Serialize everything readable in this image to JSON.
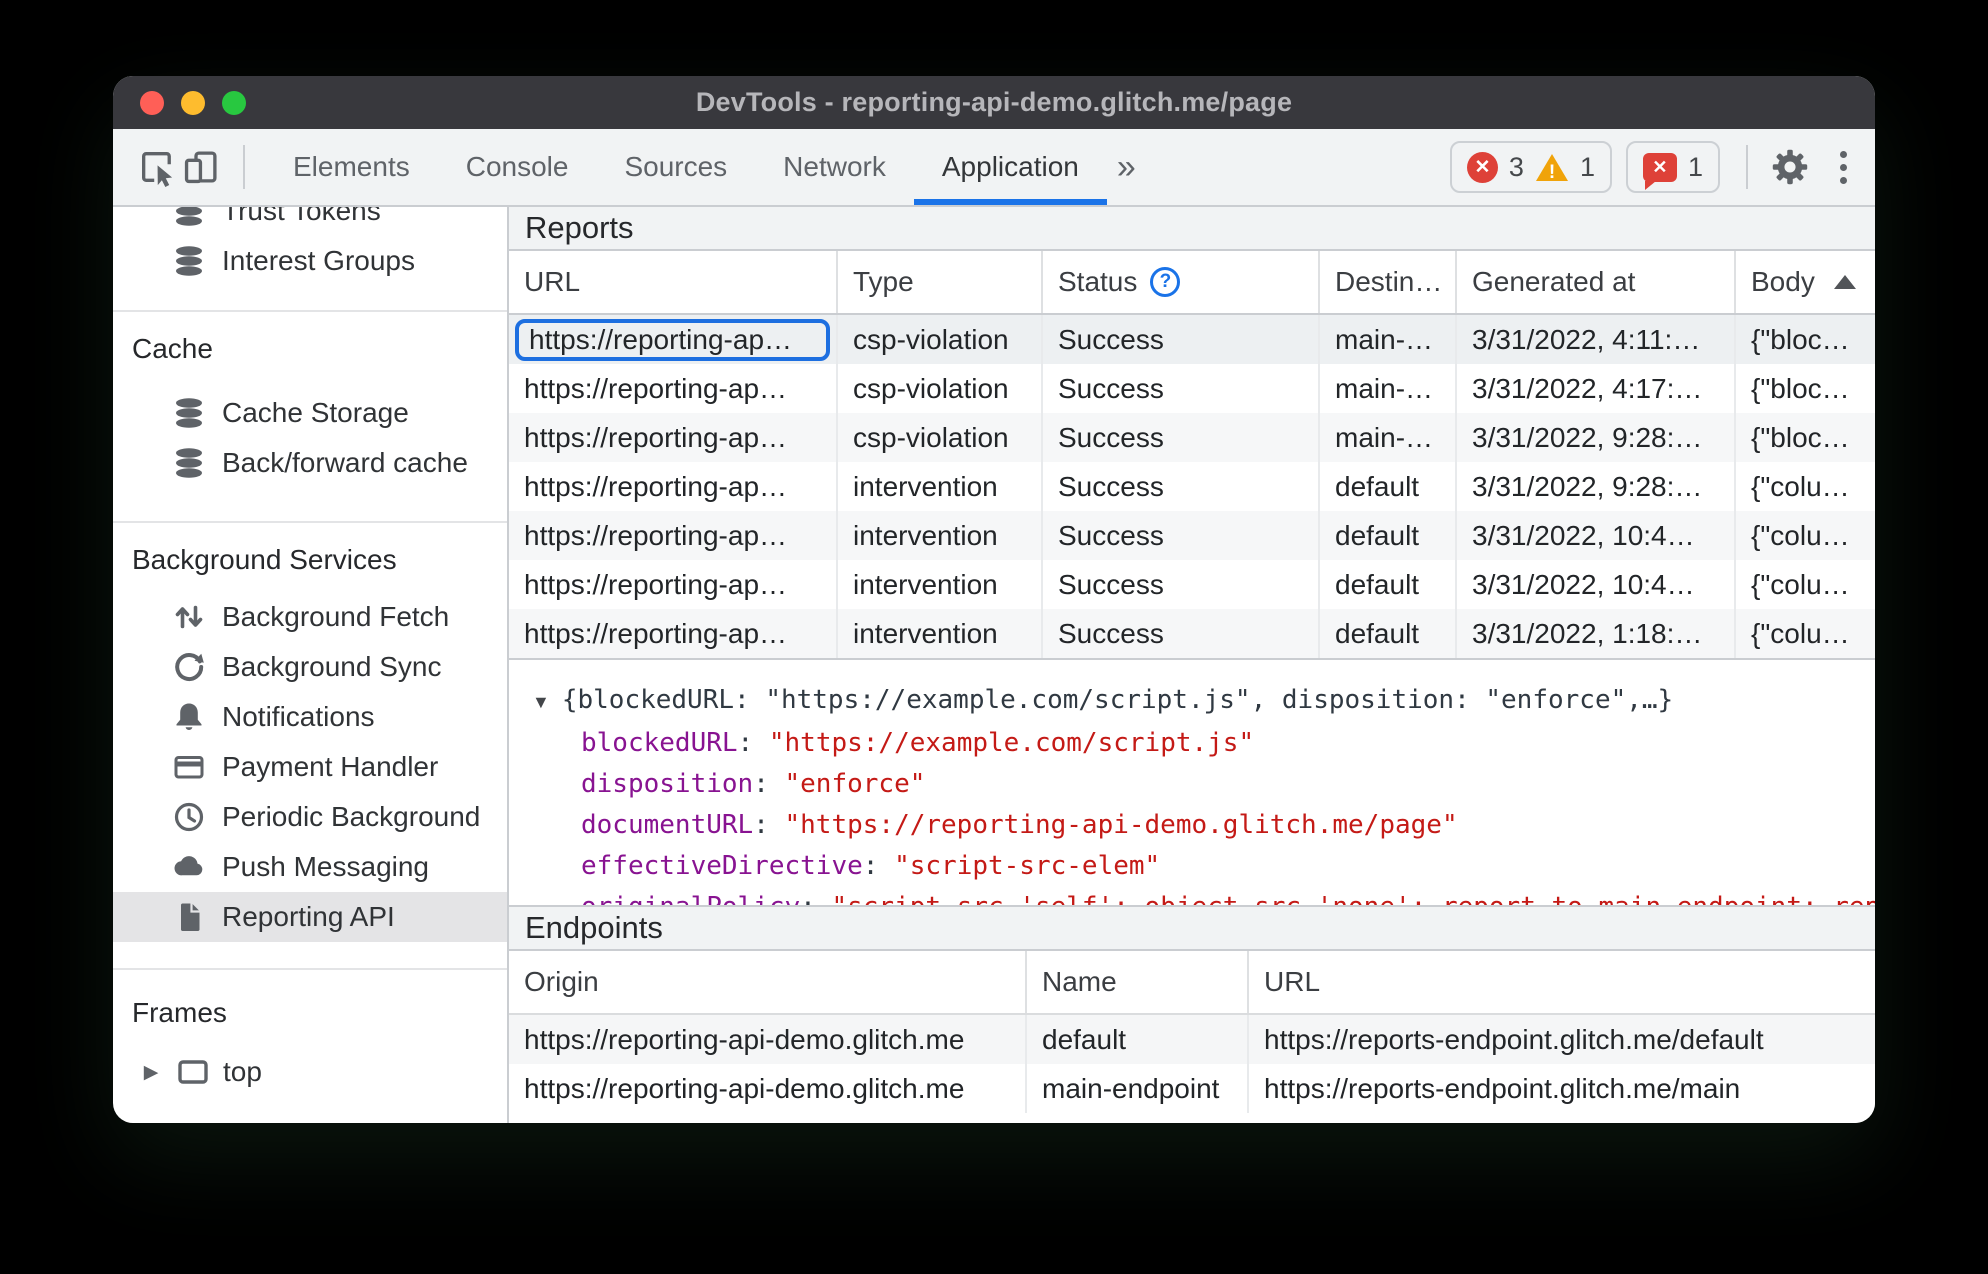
{
  "window_title": "DevTools - reporting-api-demo.glitch.me/page",
  "toolbar": {
    "tabs": {
      "elements": "Elements",
      "console": "Console",
      "sources": "Sources",
      "network": "Network",
      "application": "Application"
    },
    "more_tabs_glyph": "»",
    "badges": {
      "error_count": "3",
      "warning_count": "1",
      "issue_count": "1",
      "close_glyph": "✕",
      "warning_glyph": "!"
    }
  },
  "sidebar": {
    "item_trust_tokens": "Trust Tokens",
    "item_interest_groups": "Interest Groups",
    "section_cache": "Cache",
    "item_cache_storage": "Cache Storage",
    "item_back_forward_cache": "Back/forward cache",
    "section_background_services": "Background Services",
    "item_background_fetch": "Background Fetch",
    "item_background_sync": "Background Sync",
    "item_notifications": "Notifications",
    "item_payment_handler": "Payment Handler",
    "item_periodic_background": "Periodic Background",
    "item_push_messaging": "Push Messaging",
    "item_reporting_api": "Reporting API",
    "section_frames": "Frames",
    "item_top": "top",
    "expander_right_glyph": "▶"
  },
  "reports": {
    "title": "Reports",
    "columns": {
      "url": "URL",
      "type": "Type",
      "status": "Status",
      "status_help_glyph": "?",
      "destination": "Destin…",
      "generated_at": "Generated at",
      "body": "Body"
    },
    "rows": [
      {
        "url": "https://reporting-ap…",
        "type": "csp-violation",
        "status": "Success",
        "destination": "main-…",
        "generated_at": "3/31/2022, 4:11:…",
        "body": "{\"bloc…"
      },
      {
        "url": "https://reporting-ap…",
        "type": "csp-violation",
        "status": "Success",
        "destination": "main-…",
        "generated_at": "3/31/2022, 4:17:…",
        "body": "{\"bloc…"
      },
      {
        "url": "https://reporting-ap…",
        "type": "csp-violation",
        "status": "Success",
        "destination": "main-…",
        "generated_at": "3/31/2022, 9:28:…",
        "body": "{\"bloc…"
      },
      {
        "url": "https://reporting-ap…",
        "type": "intervention",
        "status": "Success",
        "destination": "default",
        "generated_at": "3/31/2022, 9:28:…",
        "body": "{\"colu…"
      },
      {
        "url": "https://reporting-ap…",
        "type": "intervention",
        "status": "Success",
        "destination": "default",
        "generated_at": "3/31/2022, 10:4…",
        "body": "{\"colu…"
      },
      {
        "url": "https://reporting-ap…",
        "type": "intervention",
        "status": "Success",
        "destination": "default",
        "generated_at": "3/31/2022, 10:4…",
        "body": "{\"colu…"
      },
      {
        "url": "https://reporting-ap…",
        "type": "intervention",
        "status": "Success",
        "destination": "default",
        "generated_at": "3/31/2022, 1:18:…",
        "body": "{\"colu…"
      }
    ]
  },
  "detail": {
    "expander_glyph": "▼",
    "summary": "{blockedURL: \"https://example.com/script.js\", disposition: \"enforce\",…}",
    "entries": [
      {
        "key": "blockedURL",
        "value": "\"https://example.com/script.js\""
      },
      {
        "key": "disposition",
        "value": "\"enforce\""
      },
      {
        "key": "documentURL",
        "value": "\"https://reporting-api-demo.glitch.me/page\""
      },
      {
        "key": "effectiveDirective",
        "value": "\"script-src-elem\""
      },
      {
        "key": "originalPolicy",
        "value": "\"script-src 'self'; object-src 'none'; report-to main-endpoint; report-to default\""
      }
    ]
  },
  "endpoints": {
    "title": "Endpoints",
    "columns": {
      "origin": "Origin",
      "name": "Name",
      "url": "URL"
    },
    "rows": [
      {
        "origin": "https://reporting-api-demo.glitch.me",
        "name": "default",
        "url": "https://reports-endpoint.glitch.me/default"
      },
      {
        "origin": "https://reporting-api-demo.glitch.me",
        "name": "main-endpoint",
        "url": "https://reports-endpoint.glitch.me/main"
      }
    ]
  },
  "colors": {
    "accent_blue": "#1a73e8",
    "selection_ring_blue": "#1d6fe0",
    "error_red": "#de4138",
    "warning_yellow": "#f0a30a",
    "json_key_purple": "#881391",
    "json_string_red": "#c41a16",
    "titlebar_dark": "#38383d",
    "toolbar_gray": "#f1f3f4"
  }
}
